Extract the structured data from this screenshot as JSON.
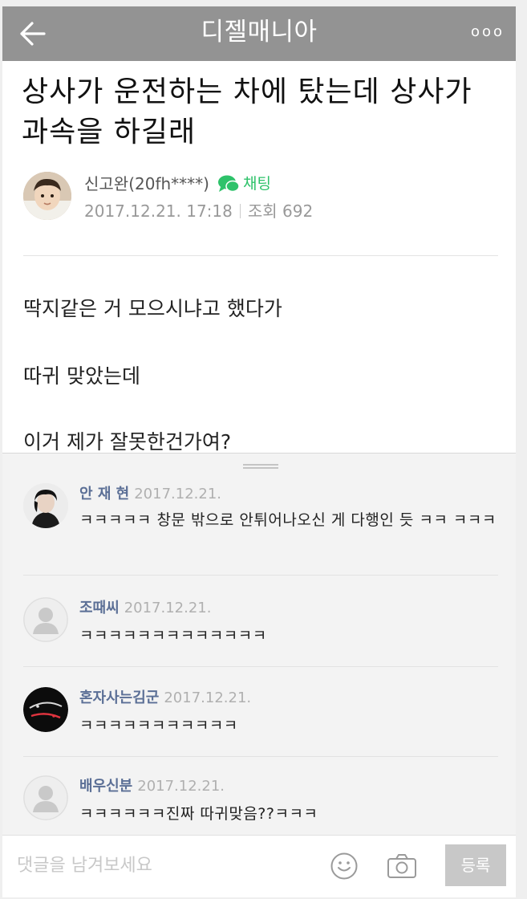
{
  "header": {
    "title": "디젤매니아",
    "more_label": "ooo"
  },
  "post": {
    "title_line1": "상사가 운전하는 차에 탔는데 상사가",
    "title_line2": "과속을 하길래",
    "author": "신고완(20fh****)",
    "chat_label": "채팅",
    "date": "2017.12.21. 17:18",
    "views": "조회 692",
    "body": [
      "딱지같은 거 모으시냐고 했다가",
      "따귀 맞았는데",
      "이거 제가 잘못한건가여?"
    ]
  },
  "comments": [
    {
      "nick": "안 재 현",
      "date": "2017.12.21.",
      "text": "ㅋㅋㅋㅋㅋ 창문 밖으로 안튀어나오신 게 다행인 듯 ㅋㅋ ㅋㅋㅋ"
    },
    {
      "nick": "조때씨",
      "date": "2017.12.21.",
      "text": "ㅋㅋㅋㅋㅋㅋㅋㅋㅋㅋㅋㅋㅋ"
    },
    {
      "nick": "혼자사는김군",
      "date": "2017.12.21.",
      "text": "ㅋㅋㅋㅋㅋㅋㅋㅋㅋㅋㅋ"
    },
    {
      "nick": "배우신분",
      "date": "2017.12.21.",
      "text": "ㅋㅋㅋㅋㅋㅋ진짜 따귀맞음??ㅋㅋㅋ"
    }
  ],
  "compose": {
    "placeholder": "댓글을 남겨보세요",
    "submit_label": "등록"
  },
  "colors": {
    "header_bg": "#939393",
    "chat_green": "#2ec26a",
    "nick_blue": "#5b6f96"
  }
}
